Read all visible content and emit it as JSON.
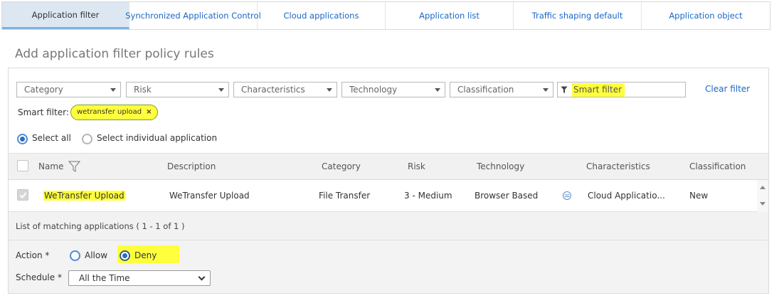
{
  "tabs": [
    {
      "label": "Application filter",
      "active": true
    },
    {
      "label": "Synchronized Application Control",
      "active": false
    },
    {
      "label": "Cloud applications",
      "active": false
    },
    {
      "label": "Application list",
      "active": false
    },
    {
      "label": "Traffic shaping default",
      "active": false
    },
    {
      "label": "Application object",
      "active": false
    }
  ],
  "page_title": "Add application filter policy rules",
  "filters": {
    "category": "Category",
    "risk": "Risk",
    "characteristics": "Characteristics",
    "technology": "Technology",
    "classification": "Classification",
    "smart_filter_placeholder": "Smart filter",
    "clear_filter": "Clear filter"
  },
  "smart_filter": {
    "label": "Smart filter:",
    "chip": "wetransfer upload",
    "chip_remove": "×"
  },
  "selection": {
    "select_all": "Select all",
    "select_individual": "Select individual application",
    "selected": "select_all"
  },
  "table": {
    "headers": {
      "name": "Name",
      "description": "Description",
      "category": "Category",
      "risk": "Risk",
      "technology": "Technology",
      "characteristics": "Characteristics",
      "classification": "Classification"
    },
    "rows": [
      {
        "checked": true,
        "name": "WeTransfer Upload",
        "description": "WeTransfer Upload",
        "category": "File Transfer",
        "risk": "3 - Medium",
        "technology": "Browser Based",
        "characteristics": "Cloud Applicatio...",
        "classification": "New"
      }
    ]
  },
  "matching_text": "List of matching applications ( 1 - 1 of 1 )",
  "action": {
    "label": "Action *",
    "allow": "Allow",
    "deny": "Deny",
    "selected": "deny"
  },
  "schedule": {
    "label": "Schedule *",
    "value": "All the Time"
  },
  "colors": {
    "accent": "#1a66c7",
    "highlight": "#ffff3d",
    "active_tab": "#dde7f1"
  }
}
